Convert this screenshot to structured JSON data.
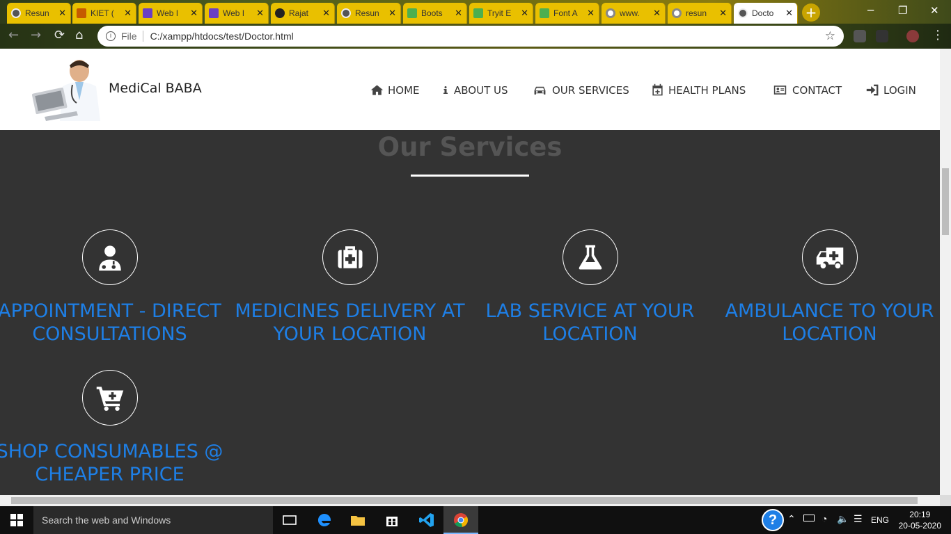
{
  "browser": {
    "tabs": [
      {
        "label": "Resun",
        "favicon": "globe-icon"
      },
      {
        "label": "KIET (",
        "favicon": "kiet-icon"
      },
      {
        "label": "Web I",
        "favicon": "list-icon"
      },
      {
        "label": "Web I",
        "favicon": "list-icon"
      },
      {
        "label": "Rajat",
        "favicon": "github-icon"
      },
      {
        "label": "Resun",
        "favicon": "globe-icon"
      },
      {
        "label": "Boots",
        "favicon": "w3-icon"
      },
      {
        "label": "Tryit E",
        "favicon": "w3-icon"
      },
      {
        "label": "Font A",
        "favicon": "w3-icon"
      },
      {
        "label": "www.",
        "favicon": "google-icon"
      },
      {
        "label": "resun",
        "favicon": "google-icon"
      },
      {
        "label": "Docto",
        "favicon": "globe-icon",
        "active": true
      }
    ],
    "address": {
      "scheme_label": "File",
      "url": "C:/xampp/htdocs/test/Doctor.html"
    }
  },
  "site": {
    "brand": "MediCal BABA",
    "nav": [
      {
        "label": "HOME",
        "icon": "home-icon"
      },
      {
        "label": "ABOUT US",
        "icon": "info-icon"
      },
      {
        "label": "OUR SERVICES",
        "icon": "car-icon"
      },
      {
        "label": "HEALTH PLANS",
        "icon": "calendar-plus-icon"
      },
      {
        "label": "CONTACT",
        "icon": "address-card-icon"
      },
      {
        "label": "LOGIN",
        "icon": "sign-in-icon"
      }
    ],
    "services_title": "Our Services",
    "services": [
      {
        "label": "Appointment - Direct Consultations",
        "icon": "doctor-icon"
      },
      {
        "label": "Medicines Delivery at your location",
        "icon": "medkit-icon"
      },
      {
        "label": "Lab Service at your location",
        "icon": "flask-icon"
      },
      {
        "label": "Ambulance to your location",
        "icon": "ambulance-icon"
      },
      {
        "label": "Shop Consumables @ cheaper price",
        "icon": "cart-plus-icon"
      }
    ]
  },
  "taskbar": {
    "search_placeholder": "Search the web and Windows",
    "language": "ENG",
    "time": "20:19",
    "date": "20-05-2020"
  },
  "colors": {
    "service_label": "#1e7fe6",
    "section_bg": "#333333",
    "tab_bg": "#e9c000"
  }
}
